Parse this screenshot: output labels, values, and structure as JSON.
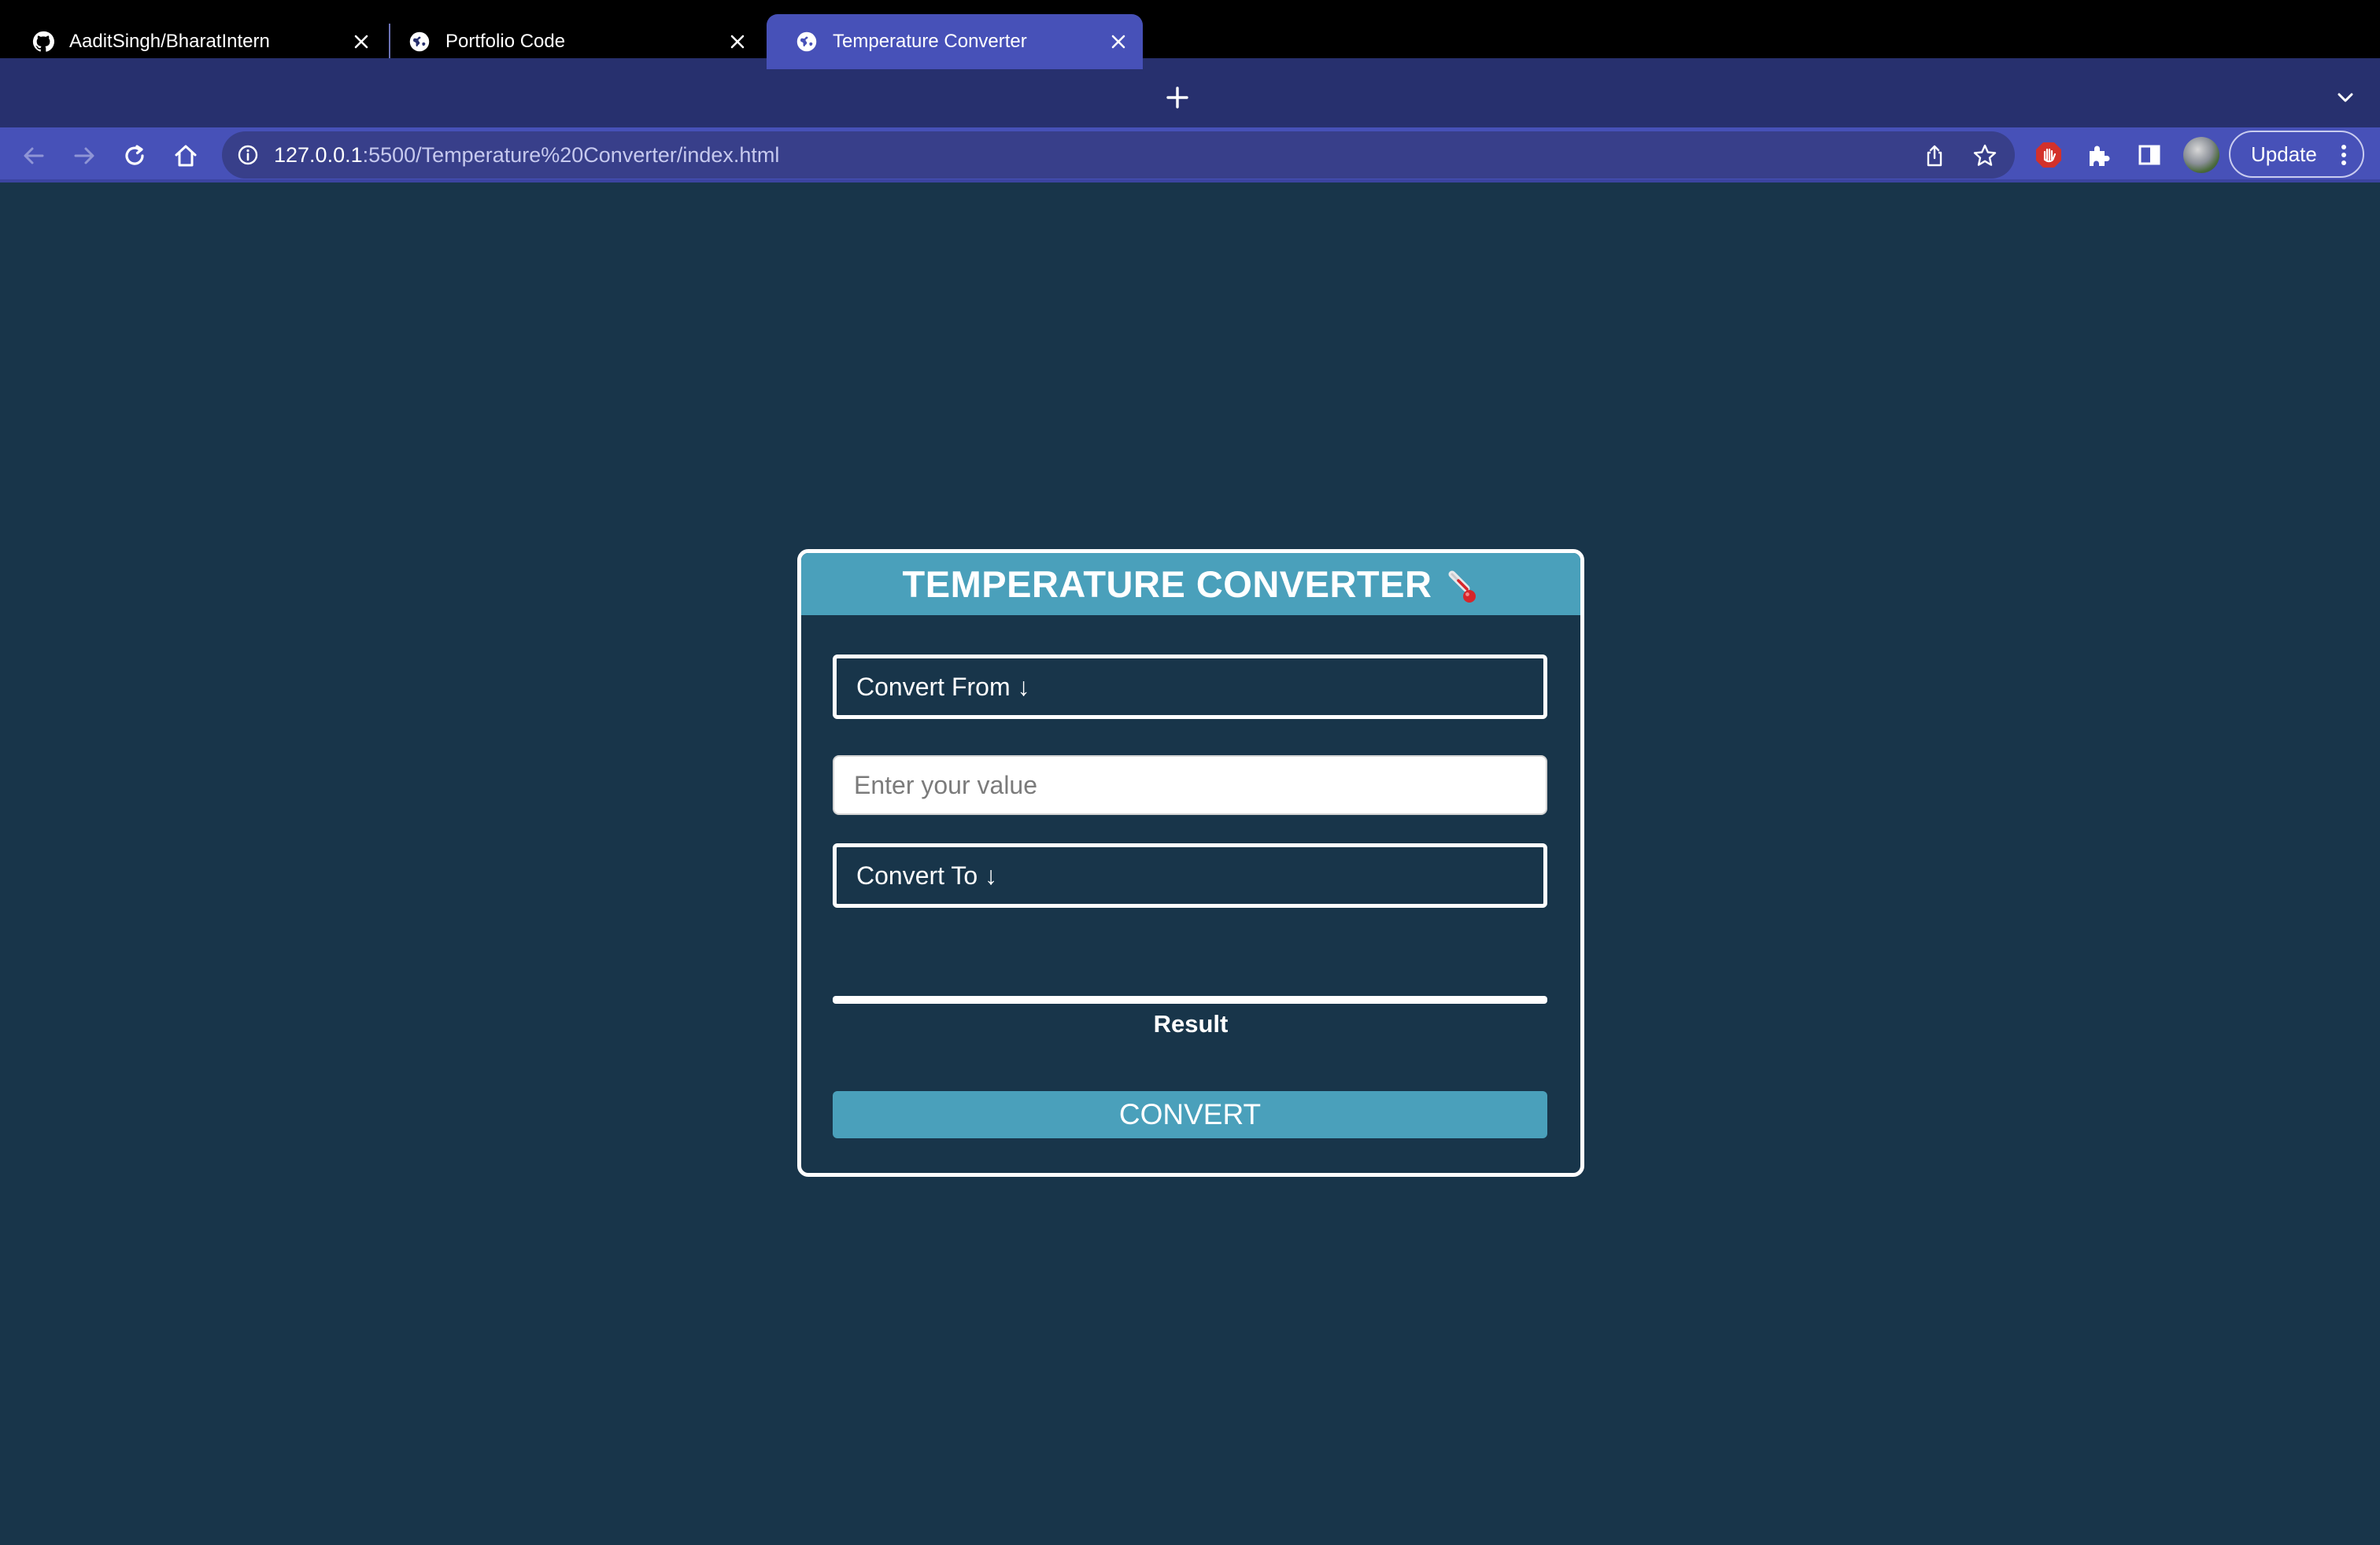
{
  "browser": {
    "tabs": [
      {
        "label": "AaditSingh/BharatIntern",
        "icon": "github-icon",
        "active": false
      },
      {
        "label": "Portfolio Code",
        "icon": "globe-icon",
        "active": false
      },
      {
        "label": "Temperature Converter",
        "icon": "globe-icon",
        "active": true
      }
    ],
    "url_host": "127.0.0.1",
    "url_rest": ":5500/Temperature%20Converter/index.html",
    "update_label": "Update",
    "colors": {
      "tabstrip": "#27306e",
      "toolbar": "#4751b8",
      "omnibox": "#383f8a"
    }
  },
  "page": {
    "background": "#18354a",
    "title": "TEMPERATURE CONVERTER",
    "title_emoji": "thermometer-icon",
    "convert_from": "Convert From ↓",
    "value_placeholder": "Enter your value",
    "convert_to": "Convert To ↓",
    "result_label": "Result",
    "convert_button": "CONVERT",
    "accent": "#4aa0bb"
  }
}
